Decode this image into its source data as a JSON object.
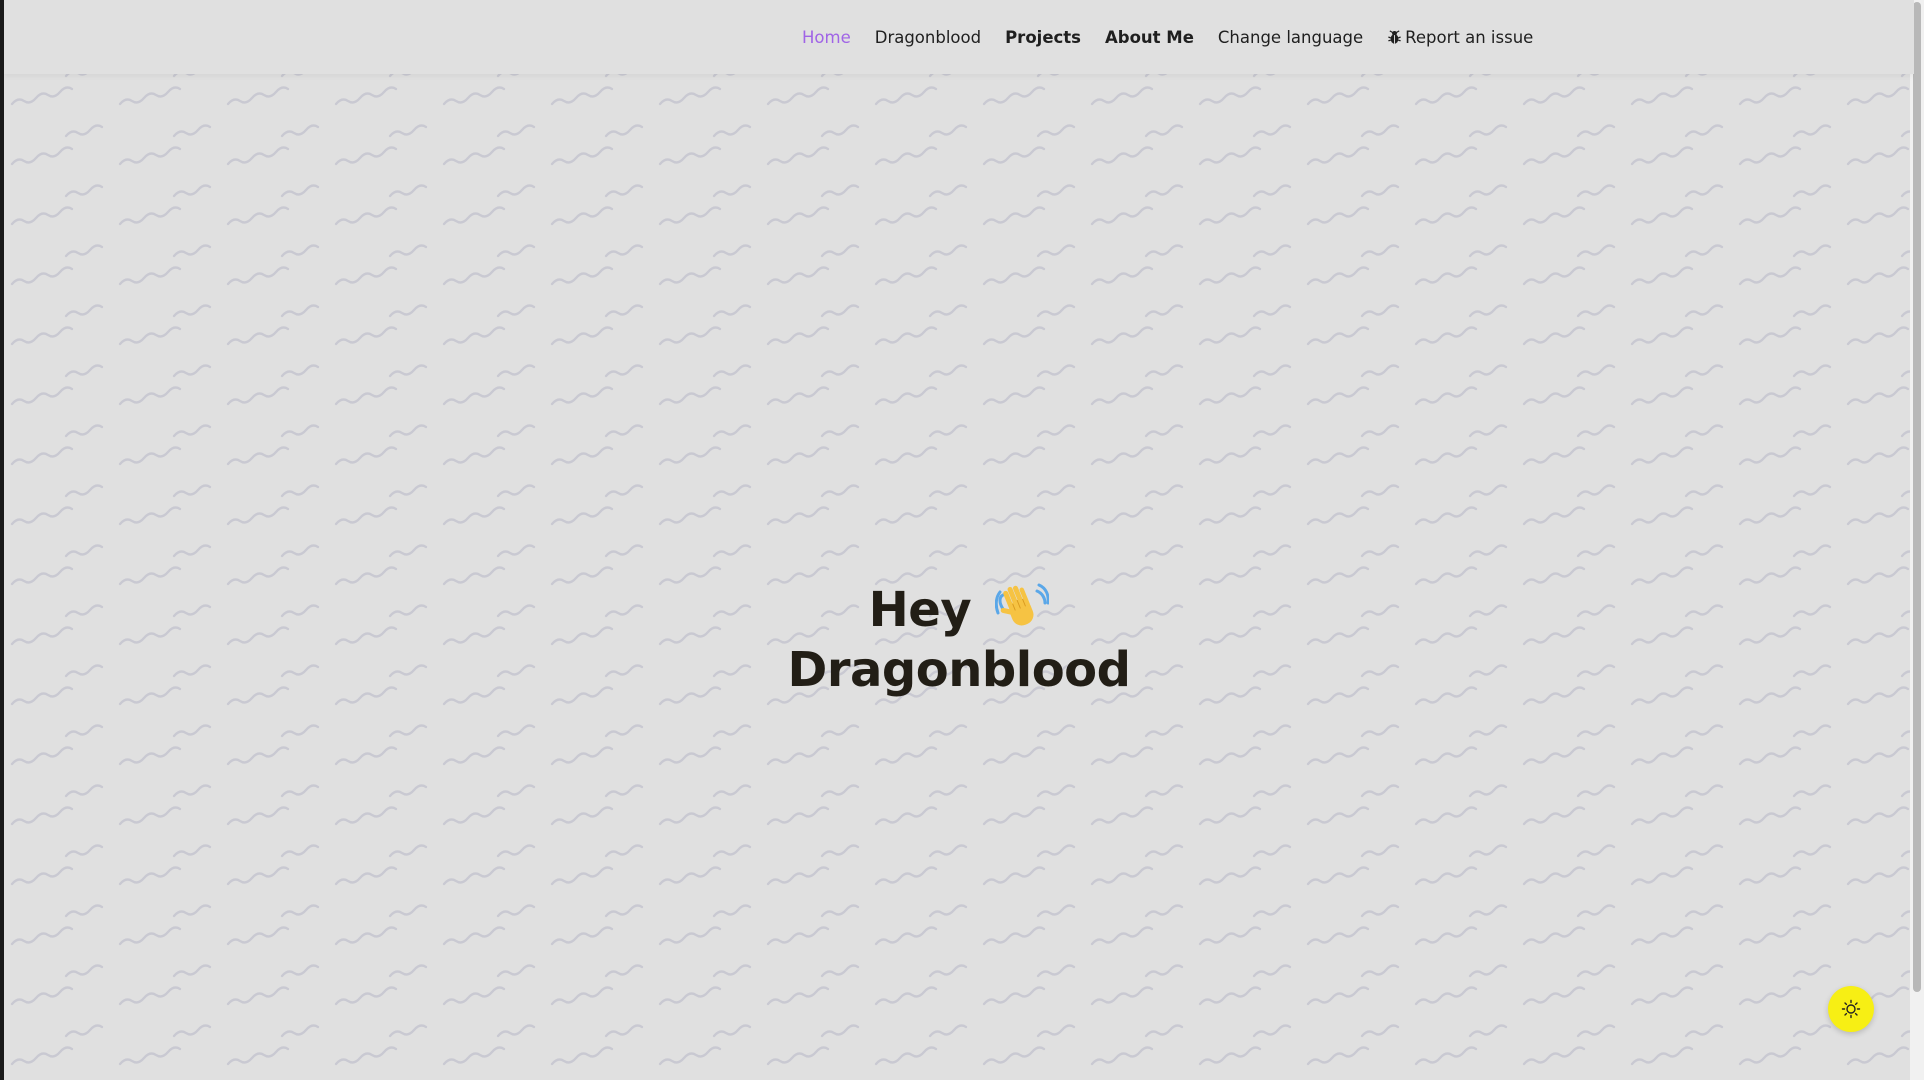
{
  "nav": {
    "items": [
      {
        "label": "Home",
        "active": true
      },
      {
        "label": "Dragonblood"
      },
      {
        "label": "Projects"
      },
      {
        "label": "About Me"
      },
      {
        "label": "Change language"
      },
      {
        "label": "Report an issue",
        "icon": "bug-icon"
      }
    ]
  },
  "hero": {
    "greeting": "Hey",
    "name": "Dragonblood",
    "emoji_icon": "waving-hand-icon"
  },
  "theme_toggle": {
    "icon": "sun-icon"
  },
  "colors": {
    "accent": "#a064e6",
    "page_background": "#e0e0e0",
    "text_dark": "#221e16",
    "toggle_yellow": "#f7ef14"
  }
}
